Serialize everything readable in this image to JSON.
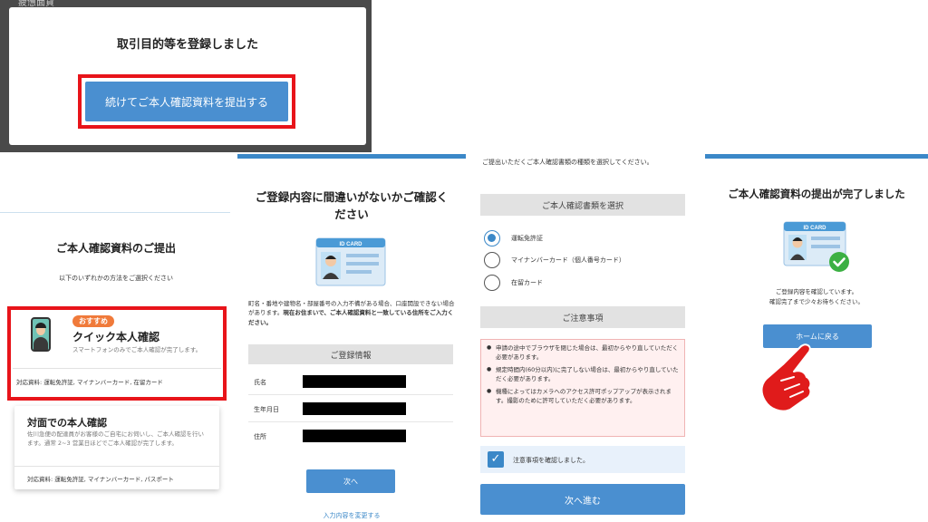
{
  "modal": {
    "background_text": "疲憊面貨",
    "title": "取引目的等を登録しました",
    "button_label": "続けてご本人確認資料を提出する"
  },
  "method_select": {
    "title": "ご本人確認資料のご提出",
    "subtitle": "以下のいずれかの方法をご選択ください",
    "quick": {
      "badge": "おすすめ",
      "title": "クイック本人確認",
      "description": "スマートフォンのみでご本人確認が完了します。",
      "documents": "対応資料: 運転免許証, マイナンバーカード, 在留カード"
    },
    "face_to_face": {
      "title": "対面での本人確認",
      "description": "佐川急便の配達員がお客様のご自宅にお伺いし、ご本人確認を行います。通常 2~3 営業日ほどでご本人確認が完了します。",
      "documents": "対応資料: 運転免許証, マイナンバーカード, パスポート"
    }
  },
  "confirm": {
    "title": "ご登録内容に間違いがないかご確認ください",
    "id_card_label": "ID CARD",
    "note_plain": "町名・番地や建物名・部屋番号の入力不備がある場合、口座開設できない場合があります。",
    "note_bold": "現在お住まいで、ご本人確認資料と一致している住所をご入力ください。",
    "section_header": "ご登録情報",
    "rows": [
      {
        "label": "氏名"
      },
      {
        "label": "生年月日"
      },
      {
        "label": "住所"
      }
    ],
    "next_button": "次へ",
    "edit_link": "入力内容を変更する"
  },
  "doc_select": {
    "intro": "ご提出いただくご本人確認書類の種類を選択してください。",
    "section_header": "ご本人確認書類を選択",
    "options": [
      {
        "label": "運転免許証",
        "selected": true
      },
      {
        "label": "マイナンバーカード（個人番号カード）",
        "selected": false
      },
      {
        "label": "在留カード",
        "selected": false
      }
    ],
    "notice_header": "ご注意事項",
    "notices": [
      "申請の途中でブラウザを閉じた場合は、最初からやり直していただく必要があります。",
      "規定時間内(60分以内)に完了しない場合は、最初からやり直していただく必要があります。",
      "機種によってはカメラへのアクセス許可ポップアップが表示されます。撮影のために許可していただく必要があります。"
    ],
    "agree_label": "注意事項を確認しました。",
    "agree_checked": true,
    "next_button": "次へ進む"
  },
  "done": {
    "title": "ご本人確認資料の提出が完了しました",
    "id_card_label": "ID CARD",
    "message_line1": "ご登録内容を確認しています。",
    "message_line2": "確認完了まで少々お待ちください。",
    "home_button": "ホームに戻る"
  },
  "colors": {
    "highlight": "#e8141a",
    "primary": "#4a8fd0",
    "accent_bar": "#3b88c8",
    "badge": "#f07a3a",
    "check_ok": "#3cb043",
    "hand": "#e01b1b"
  }
}
